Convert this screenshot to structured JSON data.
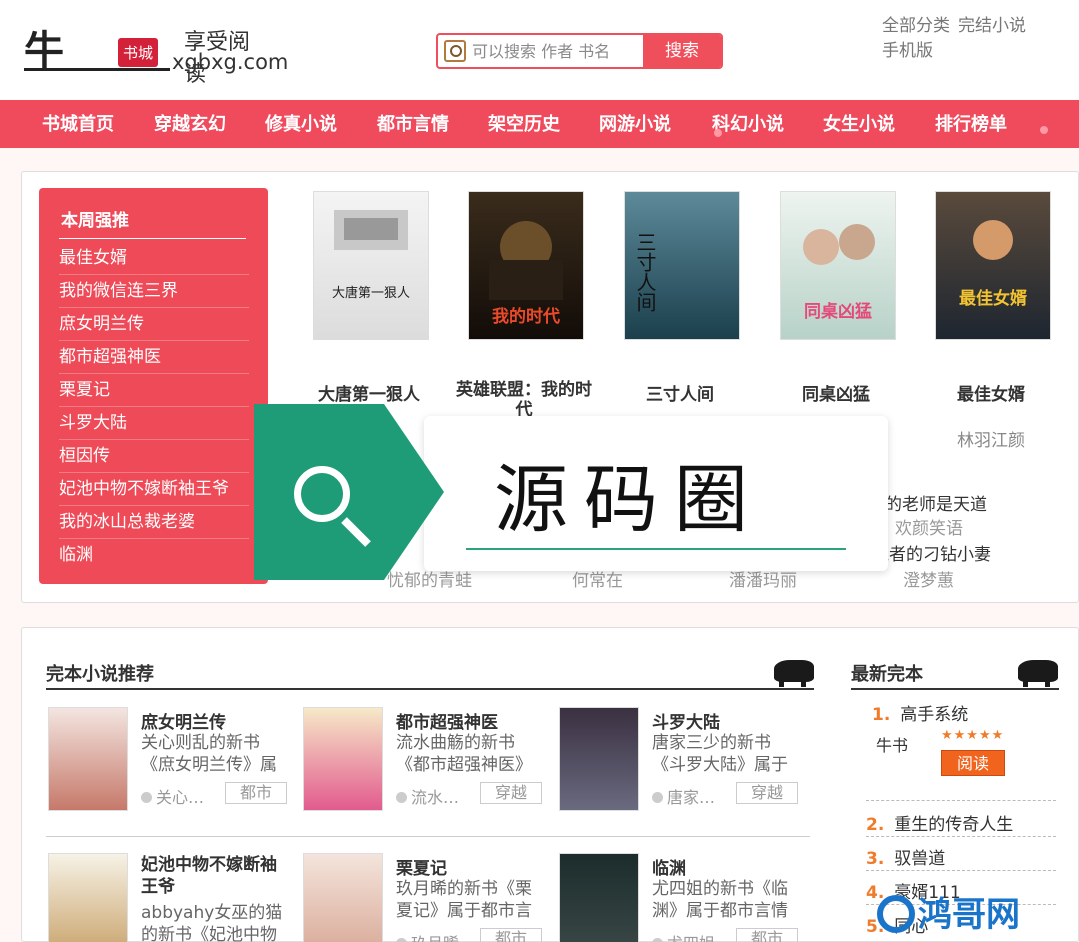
{
  "header": {
    "logo_char": "牛",
    "logo_badge": "书城",
    "logo_slogan": "享受阅读",
    "logo_domain": "xgbxg.com",
    "search_placeholder": "可以搜索 作者 书名",
    "search_button": "搜索",
    "top_links": [
      "全部分类",
      "完结小说",
      "手机版"
    ]
  },
  "nav": [
    "书城首页",
    "穿越玄幻",
    "修真小说",
    "都市言情",
    "架空历史",
    "网游小说",
    "科幻小说",
    "女生小说",
    "排行榜单"
  ],
  "weekly": {
    "title": "本周强推",
    "items": [
      "最佳女婿",
      "我的微信连三界",
      "庶女明兰传",
      "都市超强神医",
      "栗夏记",
      "斗罗大陆",
      "桓因传",
      "妃池中物不嫁断袖王爷",
      "我的冰山总裁老婆",
      "临渊"
    ]
  },
  "featured": [
    {
      "title": "大唐第一狠人",
      "author": "",
      "cover_text": "大唐第一狠人"
    },
    {
      "title": "英雄联盟：我的时代",
      "author": "",
      "cover_text": "我的时代"
    },
    {
      "title": "三寸人间",
      "author": "",
      "cover_text": "三寸人间"
    },
    {
      "title": "同桌凶猛",
      "author": "",
      "cover_text": "同桌凶猛"
    },
    {
      "title": "最佳女婿",
      "author": "林羽江颜",
      "cover_text": "最佳女婿"
    }
  ],
  "lower_rows": {
    "a": "的老师是天道",
    "b": "欢颜笑语",
    "c": "维者的刁钻小妻",
    "d": "澄梦蕙",
    "e": "忧郁的青蛙",
    "f": "何常在",
    "g": "潘潘玛丽"
  },
  "watermark": "源码圈",
  "complete": {
    "title": "完本小说推荐",
    "cards": [
      {
        "title": "庶女明兰传",
        "desc": "关心则乱的新书《庶女明兰传》属",
        "author": "关心…",
        "genre": "都市"
      },
      {
        "title": "都市超强神医",
        "desc": "流水曲觞的新书《都市超强神医》",
        "author": "流水…",
        "genre": "穿越"
      },
      {
        "title": "斗罗大陆",
        "desc": "唐家三少的新书《斗罗大陆》属于",
        "author": "唐家…",
        "genre": "穿越"
      },
      {
        "title": "妃池中物不嫁断袖王爷",
        "desc": "abbyahy女巫的猫的新书《妃池中物",
        "author": "",
        "genre": ""
      },
      {
        "title": "栗夏记",
        "desc": "玖月晞的新书《栗夏记》属于都市言",
        "author": "玖月晞",
        "genre": "都市"
      },
      {
        "title": "临渊",
        "desc": "尤四姐的新书《临渊》属于都市言情",
        "author": "尤四姐",
        "genre": "都市"
      }
    ]
  },
  "latest": {
    "title": "最新完本",
    "top": {
      "rank": "1.",
      "title": "高手系统",
      "img_alt": "牛书",
      "stars": "★★★★★",
      "button": "阅读"
    },
    "items": [
      {
        "rank": "2.",
        "title": "重生的传奇人生"
      },
      {
        "rank": "3.",
        "title": "驭兽道"
      },
      {
        "rank": "4.",
        "title": "豪婿111"
      },
      {
        "rank": "5.",
        "title": "同心"
      }
    ],
    "corner_text": "鸿哥网"
  },
  "colors": {
    "accent": "#f04a5d",
    "rank_bg": "#ee4a58",
    "wm_green": "#1e9c78",
    "orange": "#f0641e"
  }
}
